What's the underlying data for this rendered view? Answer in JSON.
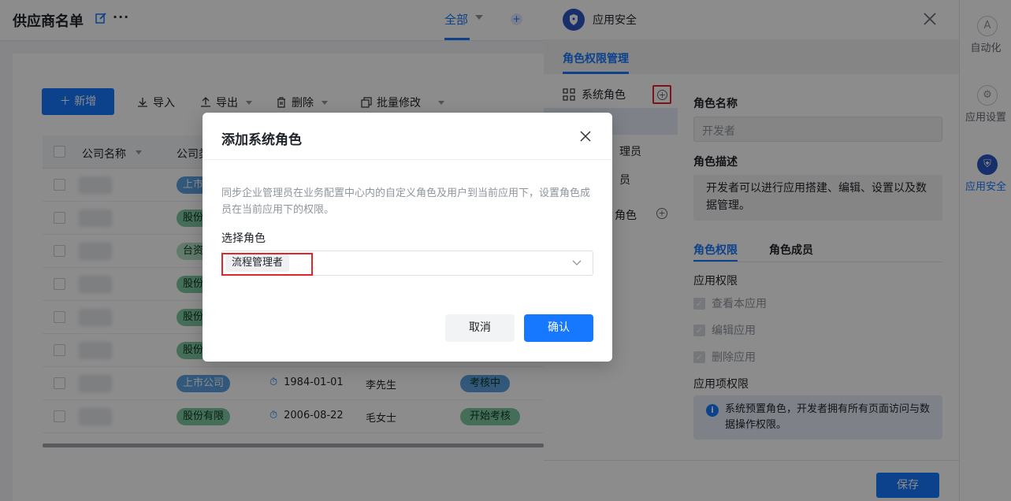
{
  "page": {
    "title": "供应商名单",
    "view_tab": "全部"
  },
  "toolbar": {
    "add_label": "新增",
    "import_label": "导入",
    "export_label": "导出",
    "delete_label": "删除",
    "batch_edit_label": "批量修改"
  },
  "table": {
    "columns": [
      "公司名称",
      "公司类"
    ],
    "rows": [
      {
        "type_tag": "上市",
        "tag_style": "blue"
      },
      {
        "type_tag": "股份",
        "tag_style": "green"
      },
      {
        "type_tag": "台资",
        "tag_style": "mint"
      },
      {
        "type_tag": "股份",
        "tag_style": "green"
      },
      {
        "type_tag": "股份",
        "tag_style": "green"
      },
      {
        "type_tag": "股份",
        "tag_style": "green"
      },
      {
        "type_tag": "上市公司",
        "tag_style": "blue",
        "date": "1984-01-01",
        "person": "李先生",
        "status": "考核中",
        "status_color": "#5ba0e0"
      },
      {
        "type_tag": "股份有限",
        "tag_style": "green",
        "date": "2006-08-22",
        "person": "毛女士",
        "status": "开始考核",
        "status_color": "#7fc8a3"
      }
    ]
  },
  "drawer": {
    "title": "应用安全",
    "tab": "角色权限管理",
    "role_group": "系统角色",
    "role_items": [
      "理员",
      "员",
      "角色"
    ],
    "role_name_label": "角色名称",
    "role_name_placeholder": "开发者",
    "role_desc_label": "角色描述",
    "role_desc_line1": "开发者可以进行应用搭建、编辑、设置以及数",
    "role_desc_line2": "据管理。",
    "sub_tabs": [
      "角色权限",
      "角色成员"
    ],
    "app_perm_label": "应用权限",
    "perms": [
      "查看本应用",
      "编辑应用",
      "删除应用"
    ],
    "item_perm_label": "应用项权限",
    "info_line1": "系统预置角色，开发者拥有所有页面访问与数",
    "info_line2": "据操作权限。",
    "save_label": "保存"
  },
  "rail": {
    "items": [
      {
        "label": "自动化",
        "icon": "automation-icon",
        "glyph": "A",
        "active": false
      },
      {
        "label": "应用设置",
        "icon": "gear-icon",
        "glyph": "⚙",
        "active": false
      },
      {
        "label": "应用安全",
        "icon": "shield-icon",
        "glyph": "⛨",
        "active": true
      }
    ]
  },
  "modal": {
    "title": "添加系统角色",
    "description": "同步企业管理员在业务配置中心内的自定义角色及用户到当前应用下，设置角色成员在当前应用下的权限。",
    "select_label": "选择角色",
    "selected_role": "流程管理者",
    "cancel_label": "取消",
    "confirm_label": "确认"
  },
  "colors": {
    "accent": "#1677ff",
    "highlight_border": "#e0262d"
  }
}
